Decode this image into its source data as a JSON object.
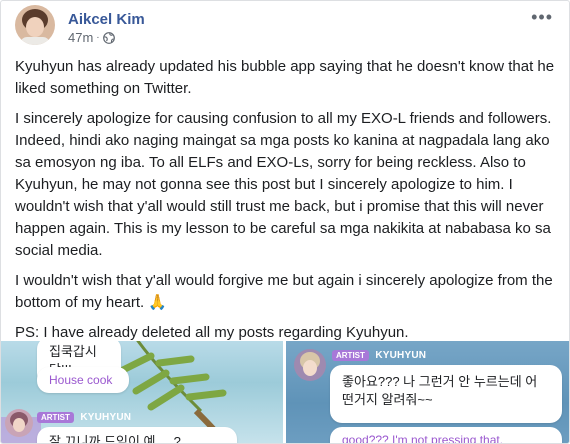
{
  "post": {
    "author": "Aikcel Kim",
    "time": "47m",
    "separator": "·",
    "more": "•••",
    "paragraphs": [
      "Kyuhyun has already updated his bubble app saying that he doesn't know that he liked something on Twitter.",
      "I sincerely apologize for causing confusion to all my EXO-L friends and followers. Indeed, hindi ako naging maingat sa mga posts ko kanina at nagpadala lang ako sa emosyon ng iba. To all ELFs and EXO-Ls, sorry for being reckless. Also to Kyuhyun, he may not gonna see this post but I sincerely apologize to him. I wouldn't wish that y'all would still trust me back, but i promise that this will never happen again. This is my lesson to be careful sa mga nakikita at nababasa ko sa social media.",
      "I wouldn't wish that y'all would forgive me but again i sincerely apologize from the bottom of my heart. 🙏",
      "PS: I have already deleted all my posts regarding Kyuhyun."
    ]
  },
  "screenshots": {
    "left": {
      "top_bubble_korean": "집쿡갑시당!!!",
      "top_bubble_translation": "House cook",
      "badge": "ARTIST",
      "artist": "KYUHYUN",
      "bottom_bubble_partial": "잘 끄니까 드임이 예 ... ?"
    },
    "right": {
      "badge": "ARTIST",
      "artist": "KYUHYUN",
      "bubble_korean_1": "좋아요??? 나 그런거 안 누르는데 어",
      "bubble_korean_2": "떤거지 알려줘~~",
      "bubble_translation": "good??? I'm not pressing that."
    }
  },
  "colors": {
    "author": "#385898",
    "meta": "#606770",
    "badge": "#a878d8",
    "translation": "#9a58cf"
  },
  "icons": {
    "privacy": "globe-icon",
    "menu": "more-options-icon"
  }
}
